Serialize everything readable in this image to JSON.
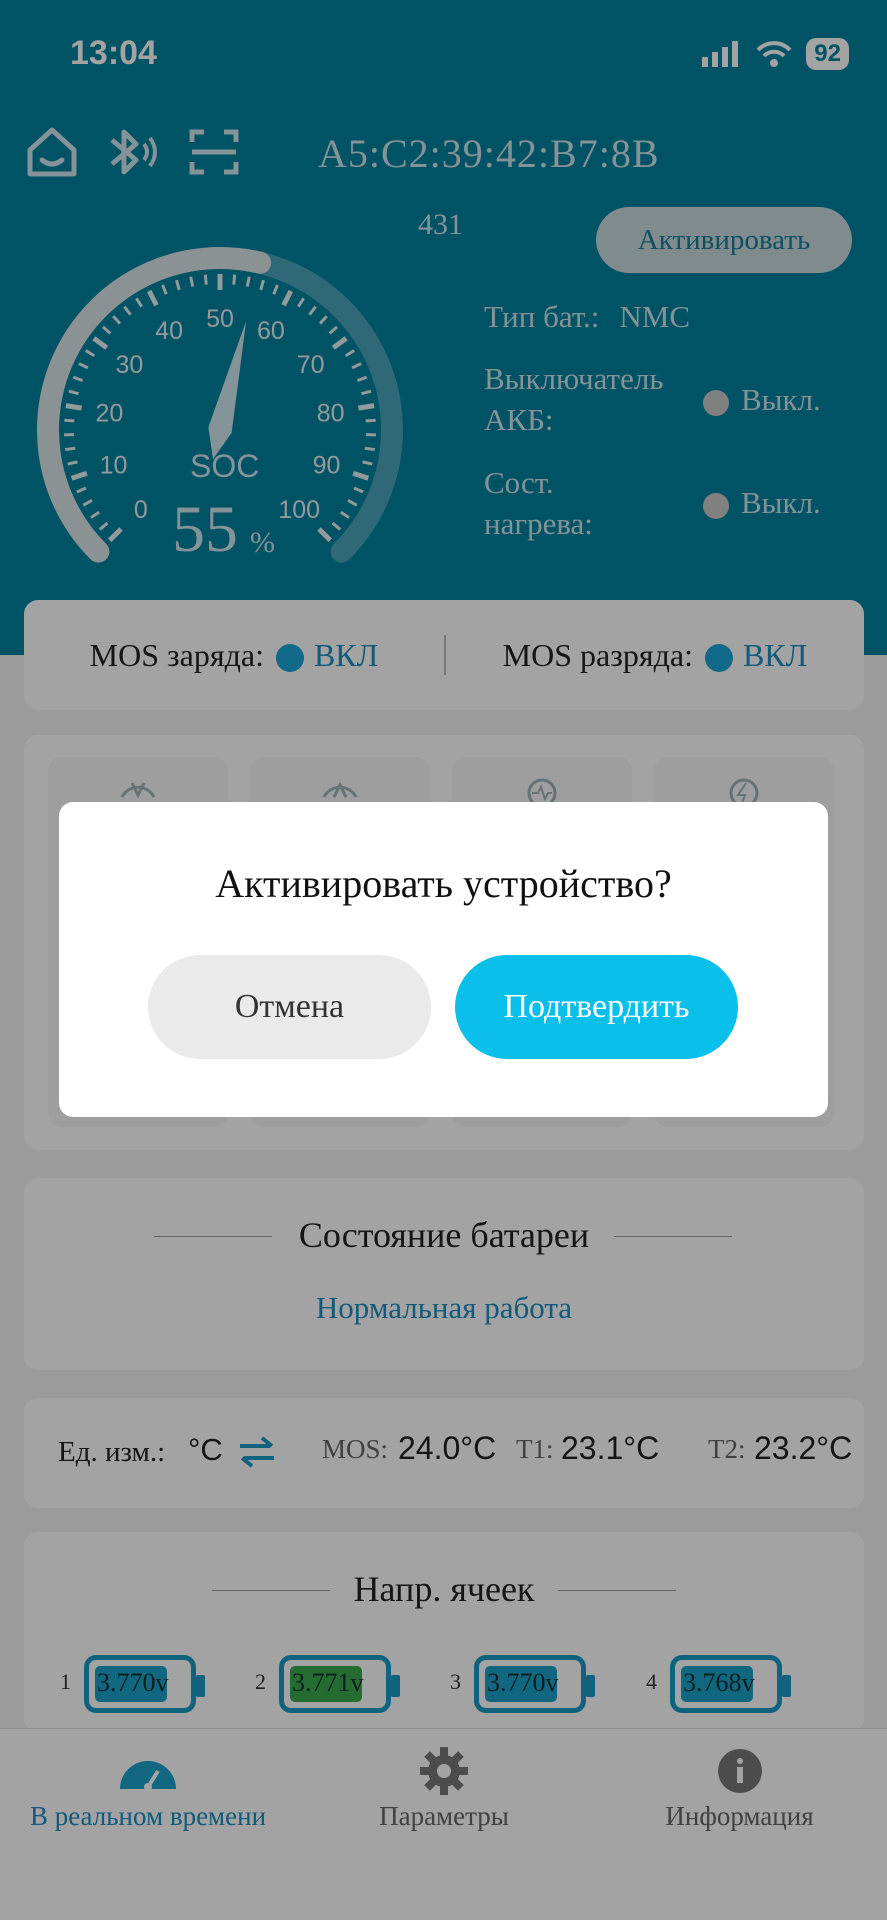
{
  "status_bar": {
    "time": "13:04",
    "battery": "92"
  },
  "header": {
    "mac": "A5:C2:39:42:B7:8B",
    "sub_number": "431",
    "activate_label": "Активировать",
    "gauge": {
      "label": "SOC",
      "value": "55",
      "unit": "%",
      "soc_level": 55,
      "ticks": [
        "0",
        "10",
        "20",
        "30",
        "40",
        "50",
        "60",
        "70",
        "80",
        "90",
        "100"
      ]
    },
    "battery_type_label": "Тип бат.:",
    "battery_type_value": "NMC",
    "switch_label_1": "Выключатель",
    "switch_label_2": "АКБ:",
    "switch_value": "Выкл.",
    "heat_label_1": "Сост.",
    "heat_label_2": "нагрева:",
    "heat_value": "Выкл."
  },
  "mos": {
    "charge_label": "MOS заряда:",
    "charge_value": "ВКЛ",
    "discharge_label": "MOS разряда:",
    "discharge_value": "ВКЛ"
  },
  "battery_state": {
    "title": "Состояние батареи",
    "status": "Нормальная работа"
  },
  "temps": {
    "unit_label": "Ед. изм.:",
    "unit_value": "°C",
    "mos_label": "MOS:",
    "mos_value": "24.0°C",
    "t1_label": "T1:",
    "t1_value": "23.1°C",
    "t2_label": "T2:",
    "t2_value": "23.2°C"
  },
  "cells": {
    "title": "Напр. ячеек",
    "items": [
      {
        "index": "1",
        "value": "3.770",
        "unit": "v",
        "color": "#1ba0c8"
      },
      {
        "index": "2",
        "value": "3.771",
        "unit": "v",
        "color": "#3aaa4f"
      },
      {
        "index": "3",
        "value": "3.770",
        "unit": "v",
        "color": "#1ba0c8"
      },
      {
        "index": "4",
        "value": "3.768",
        "unit": "v",
        "color": "#1ba0c8"
      }
    ]
  },
  "tabbar": {
    "realtime": "В реальном времени",
    "params": "Параметры",
    "info": "Информация",
    "active_color": "#1ba0c8"
  },
  "dialog": {
    "title": "Активировать устройство?",
    "cancel": "Отмена",
    "confirm": "Подтвердить"
  }
}
